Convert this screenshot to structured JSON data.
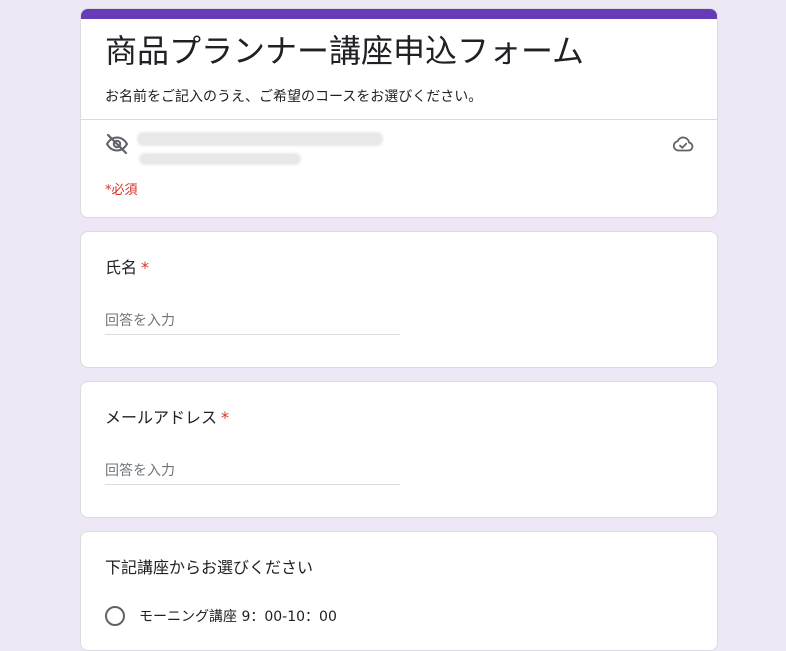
{
  "form": {
    "title": "商品プランナー講座申込フォーム",
    "description": "お名前をご記入のうえ、ご希望のコースをお選びください。",
    "required_note": "*必須"
  },
  "questions": {
    "name": {
      "label": "氏名",
      "required_mark": "*",
      "placeholder": "回答を入力"
    },
    "email": {
      "label": "メールアドレス",
      "required_mark": "*",
      "placeholder": "回答を入力"
    },
    "course": {
      "label": "下記講座からお選びください",
      "options": [
        "モーニング講座 9：00-10：00"
      ]
    }
  },
  "icons": {
    "visibility": "eye-off-icon",
    "save_status": "cloud-done-icon"
  },
  "colors": {
    "accent": "#673ab7",
    "page_background": "#ede7f6",
    "required": "#d93025"
  }
}
